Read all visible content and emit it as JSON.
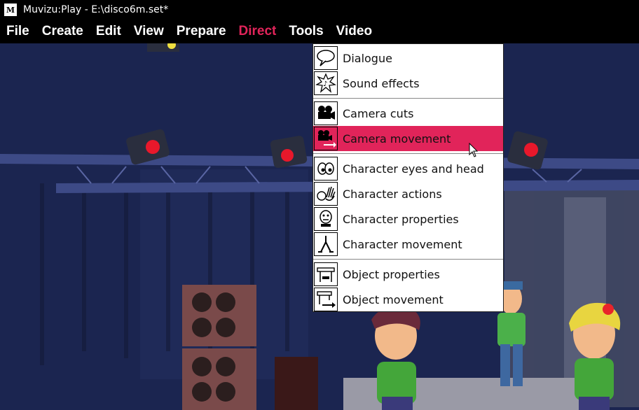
{
  "window": {
    "title": "Muvizu:Play - E:\\disco6m.set*",
    "app_icon_text": "M"
  },
  "menubar": {
    "items": [
      "File",
      "Create",
      "Edit",
      "View",
      "Prepare",
      "Direct",
      "Tools",
      "Video"
    ],
    "active": "Direct",
    "active_color": "#e1245a"
  },
  "direct_menu": {
    "groups": [
      [
        {
          "label": "Dialogue",
          "icon": "speech-bubble-icon"
        },
        {
          "label": "Sound effects",
          "icon": "music-burst-icon"
        }
      ],
      [
        {
          "label": "Camera cuts",
          "icon": "movie-camera-icon"
        },
        {
          "label": "Camera movement",
          "icon": "movie-camera-arrow-icon",
          "highlighted": true
        }
      ],
      [
        {
          "label": "Character eyes and head",
          "icon": "eyes-icon"
        },
        {
          "label": "Character actions",
          "icon": "waving-hand-icon"
        },
        {
          "label": "Character properties",
          "icon": "character-face-icon"
        },
        {
          "label": "Character movement",
          "icon": "walking-legs-icon"
        }
      ],
      [
        {
          "label": "Object properties",
          "icon": "object-slider-icon"
        },
        {
          "label": "Object movement",
          "icon": "object-arrow-icon"
        }
      ]
    ],
    "highlight_color": "#e1245a"
  }
}
